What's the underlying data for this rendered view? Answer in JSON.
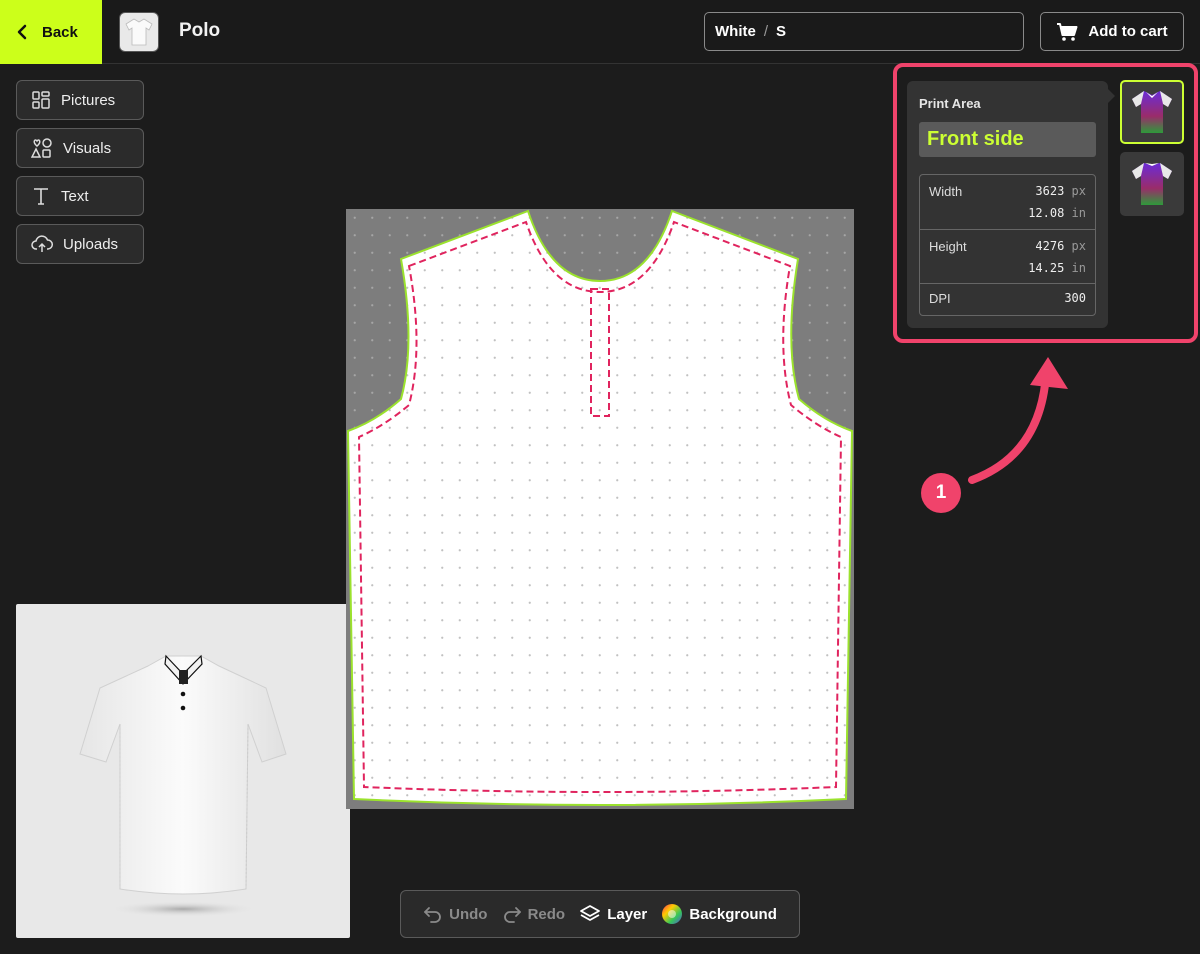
{
  "header": {
    "back_label": "Back",
    "product_name": "Polo",
    "variant": {
      "color": "White",
      "separator": "/",
      "size": "S"
    },
    "add_to_cart_label": "Add to cart"
  },
  "tools": [
    {
      "label": "Pictures",
      "icon": "grid-icon"
    },
    {
      "label": "Visuals",
      "icon": "shapes-icon"
    },
    {
      "label": "Text",
      "icon": "text-icon"
    },
    {
      "label": "Uploads",
      "icon": "cloud-upload-icon"
    }
  ],
  "toolbar": {
    "undo_label": "Undo",
    "redo_label": "Redo",
    "layer_label": "Layer",
    "background_label": "Background"
  },
  "print_area": {
    "label": "Print Area",
    "side": "Front side",
    "width_label": "Width",
    "width_px": "3623",
    "width_in": "12.08",
    "height_label": "Height",
    "height_px": "4276",
    "height_in": "14.25",
    "dpi_label": "DPI",
    "dpi": "300",
    "unit_px": "px",
    "unit_in": "in"
  },
  "annotation": {
    "step": "1"
  },
  "colors": {
    "accent": "#ccff1a",
    "highlight": "#f0436b",
    "cut_line": "#9be22d",
    "safe_line": "#e0245e"
  }
}
